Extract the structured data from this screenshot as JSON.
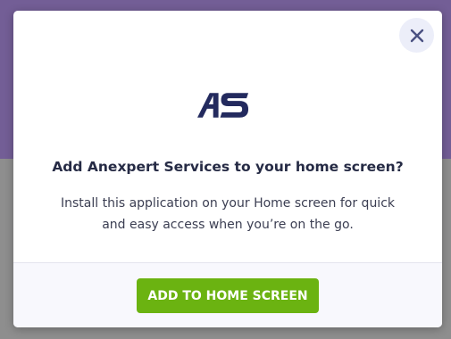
{
  "dialog": {
    "logo_text": "AS",
    "title": "Add Anexpert Services to your home screen?",
    "description": "Install this application on your Home screen for quick and easy access when you’re on the go.",
    "add_button_label": "ADD TO HOME SCREEN",
    "close_icon": "close-icon"
  },
  "colors": {
    "backdrop_top": "#735e96",
    "backdrop_bottom": "#8e8e8e",
    "primary_button": "#6bb311",
    "logo_navy": "#232a5e",
    "title_text": "#262b45"
  }
}
